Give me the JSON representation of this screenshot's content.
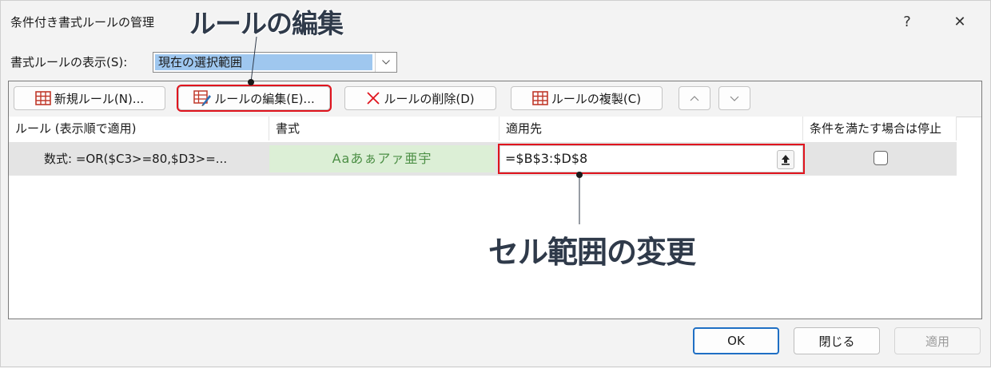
{
  "dialog": {
    "title": "条件付き書式ルールの管理",
    "help": "?",
    "close": "✕"
  },
  "annotations": {
    "edit_rule": "ルールの編集",
    "change_range": "セル範囲の変更",
    "highlight_color": "#e0141e"
  },
  "show_rules": {
    "label": "書式ルールの表示(S):",
    "selected": "現在の選択範囲"
  },
  "toolbar": {
    "new_rule": "新規ルール(N)...",
    "edit_rule": "ルールの編集(E)...",
    "delete_rule": "ルールの削除(D)",
    "duplicate_rule": "ルールの複製(C)",
    "move_up": "^",
    "move_down": "v"
  },
  "table": {
    "headers": [
      "ルール (表示順で適用)",
      "書式",
      "適用先",
      "条件を満たす場合は停止"
    ],
    "rows": [
      {
        "rule": "数式: =OR($C3>=80,$D3>=...",
        "format_preview": "Aaあぁアァ亜宇",
        "applies_to": "=$B$3:$D$8",
        "stop_if_true": false
      }
    ]
  },
  "footer": {
    "ok": "OK",
    "close": "閉じる",
    "apply": "適用"
  },
  "colors": {
    "preview_bg": "#dcefd6",
    "preview_text": "#4c8f45",
    "selection": "#9fc7ef"
  }
}
